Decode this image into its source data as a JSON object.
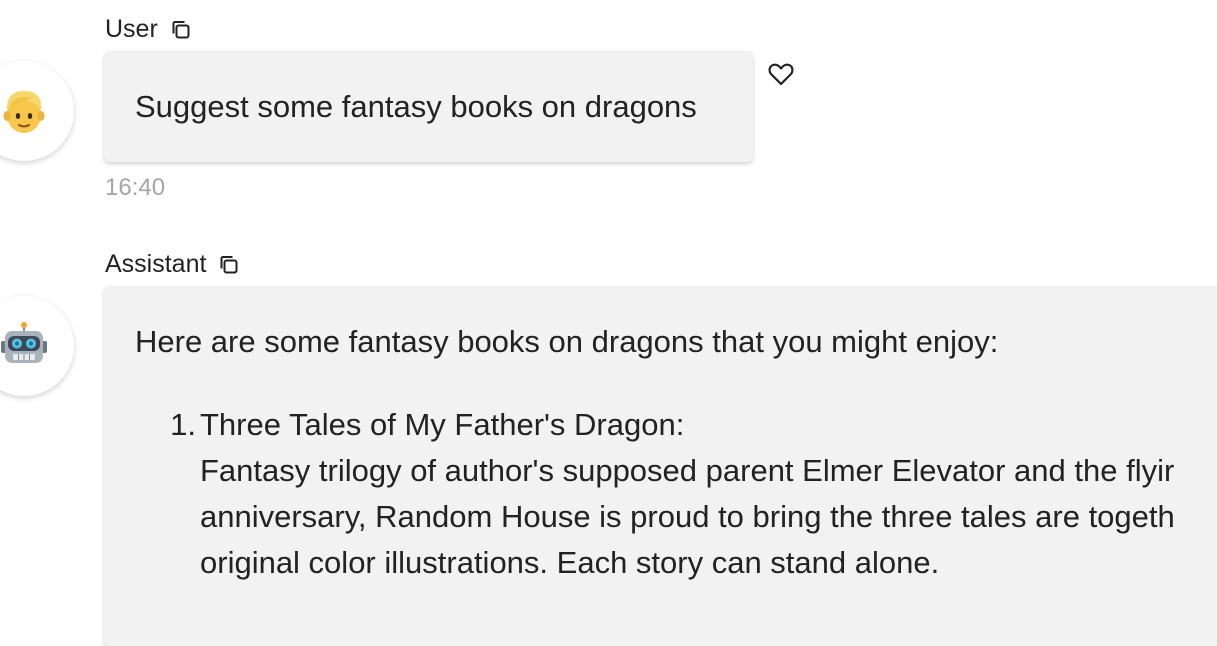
{
  "messages": {
    "user": {
      "role_label": "User",
      "avatar_icon": "person-blond-hair-emoji",
      "text": "Suggest some fantasy books on dragons",
      "timestamp": "16:40"
    },
    "assistant": {
      "role_label": "Assistant",
      "avatar_icon": "robot-emoji",
      "intro": "Here are some fantasy books on dragons that you might enjoy:",
      "items": [
        {
          "number": "1.",
          "title": "Three Tales of My Father's Dragon:",
          "lines": [
            "Fantasy trilogy of author's supposed parent Elmer Elevator and the flyir",
            "anniversary, Random House is proud to bring the three tales are togeth",
            "original color illustrations. Each story can stand alone."
          ]
        }
      ]
    }
  },
  "icons": {
    "copy": "copy-icon",
    "like": "heart-icon"
  },
  "colors": {
    "bubble_bg": "#f2f2f2",
    "text": "#222222",
    "timestamp": "#a5a5a5"
  }
}
